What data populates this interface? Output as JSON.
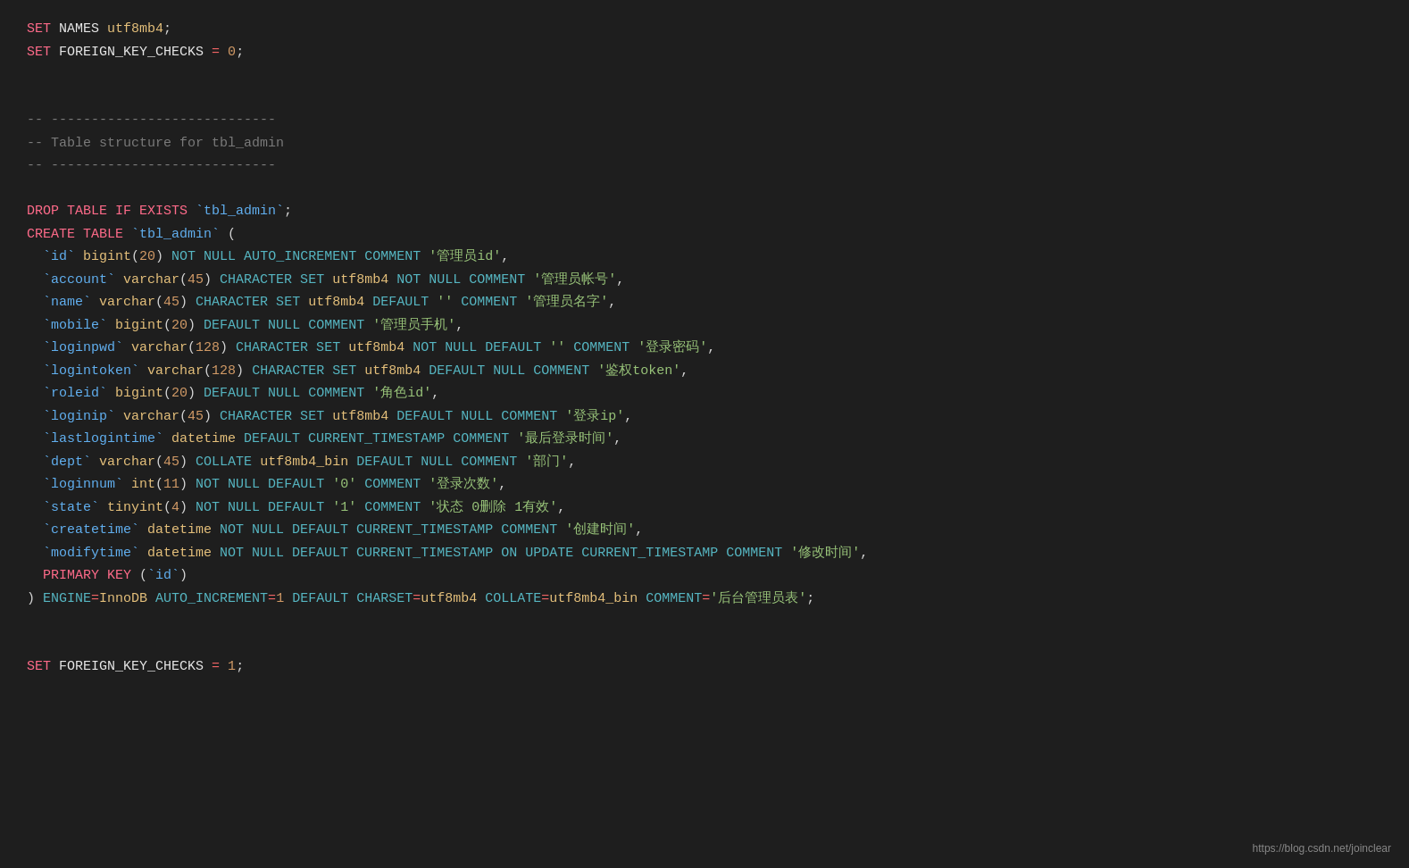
{
  "watermark": "https://blog.csdn.net/joinclear",
  "code": {
    "lines": [
      {
        "id": "l1",
        "content": "SET NAMES utf8mb4;"
      },
      {
        "id": "l2",
        "content": "SET FOREIGN_KEY_CHECKS = 0;"
      },
      {
        "id": "l3",
        "content": ""
      },
      {
        "id": "l4",
        "content": ""
      },
      {
        "id": "l5",
        "content": "-- ----------------------------"
      },
      {
        "id": "l6",
        "content": "-- Table structure for tbl_admin"
      },
      {
        "id": "l7",
        "content": "-- ----------------------------"
      },
      {
        "id": "l8",
        "content": ""
      },
      {
        "id": "l9",
        "content": "DROP TABLE IF EXISTS `tbl_admin`;"
      },
      {
        "id": "l10",
        "content": "CREATE TABLE `tbl_admin` ("
      },
      {
        "id": "l11",
        "content": "  `id` bigint(20) NOT NULL AUTO_INCREMENT COMMENT '管理员id',"
      },
      {
        "id": "l12",
        "content": "  `account` varchar(45) CHARACTER SET utf8mb4 NOT NULL COMMENT '管理员帐号',"
      },
      {
        "id": "l13",
        "content": "  `name` varchar(45) CHARACTER SET utf8mb4 DEFAULT '' COMMENT '管理员名字',"
      },
      {
        "id": "l14",
        "content": "  `mobile` bigint(20) DEFAULT NULL COMMENT '管理员手机',"
      },
      {
        "id": "l15",
        "content": "  `loginpwd` varchar(128) CHARACTER SET utf8mb4 NOT NULL DEFAULT '' COMMENT '登录密码',"
      },
      {
        "id": "l16",
        "content": "  `logintoken` varchar(128) CHARACTER SET utf8mb4 DEFAULT NULL COMMENT '鉴权token',"
      },
      {
        "id": "l17",
        "content": "  `roleid` bigint(20) DEFAULT NULL COMMENT '角色id',"
      },
      {
        "id": "l18",
        "content": "  `loginip` varchar(45) CHARACTER SET utf8mb4 DEFAULT NULL COMMENT '登录ip',"
      },
      {
        "id": "l19",
        "content": "  `lastlogintime` datetime DEFAULT CURRENT_TIMESTAMP COMMENT '最后登录时间',"
      },
      {
        "id": "l20",
        "content": "  `dept` varchar(45) COLLATE utf8mb4_bin DEFAULT NULL COMMENT '部门',"
      },
      {
        "id": "l21",
        "content": "  `loginnum` int(11) NOT NULL DEFAULT '0' COMMENT '登录次数',"
      },
      {
        "id": "l22",
        "content": "  `state` tinyint(4) NOT NULL DEFAULT '1' COMMENT '状态 0删除 1有效',"
      },
      {
        "id": "l23",
        "content": "  `createtime` datetime NOT NULL DEFAULT CURRENT_TIMESTAMP COMMENT '创建时间',"
      },
      {
        "id": "l24",
        "content": "  `modifytime` datetime NOT NULL DEFAULT CURRENT_TIMESTAMP ON UPDATE CURRENT_TIMESTAMP COMMENT '修改时间',"
      },
      {
        "id": "l25",
        "content": "  PRIMARY KEY (`id`)"
      },
      {
        "id": "l26",
        "content": ") ENGINE=InnoDB AUTO_INCREMENT=1 DEFAULT CHARSET=utf8mb4 COLLATE=utf8mb4_bin COMMENT='后台管理员表';"
      },
      {
        "id": "l27",
        "content": ""
      },
      {
        "id": "l28",
        "content": ""
      },
      {
        "id": "l29",
        "content": "SET FOREIGN_KEY_CHECKS = 1;"
      }
    ]
  }
}
